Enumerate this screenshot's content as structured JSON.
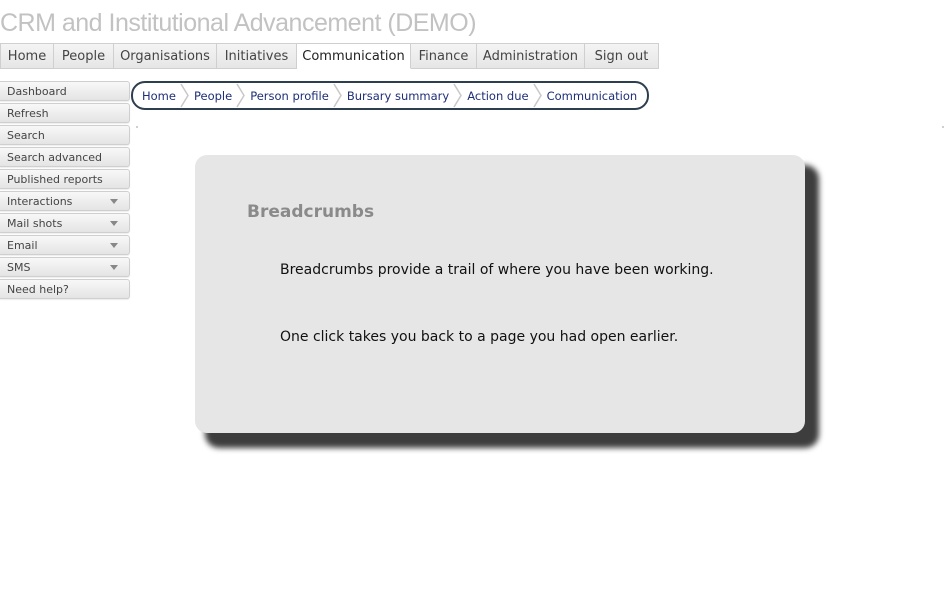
{
  "app": {
    "title": "CRM and Institutional Advancement (DEMO)"
  },
  "main_nav": {
    "tabs": [
      {
        "label": "Home",
        "active": false
      },
      {
        "label": "People",
        "active": false
      },
      {
        "label": "Organisations",
        "active": false
      },
      {
        "label": "Initiatives",
        "active": false
      },
      {
        "label": "Communication",
        "active": true
      },
      {
        "label": "Finance",
        "active": false
      },
      {
        "label": "Administration",
        "active": false
      },
      {
        "label": "Sign out",
        "active": false
      }
    ]
  },
  "side_nav": {
    "items": [
      {
        "label": "Dashboard",
        "has_submenu": false
      },
      {
        "label": "Refresh",
        "has_submenu": false
      },
      {
        "label": "Search",
        "has_submenu": false
      },
      {
        "label": "Search advanced",
        "has_submenu": false
      },
      {
        "label": "Published reports",
        "has_submenu": false
      },
      {
        "label": "Interactions",
        "has_submenu": true
      },
      {
        "label": "Mail shots",
        "has_submenu": true
      },
      {
        "label": "Email",
        "has_submenu": true
      },
      {
        "label": "SMS",
        "has_submenu": true
      },
      {
        "label": "Need help?",
        "has_submenu": false
      }
    ]
  },
  "breadcrumb": {
    "items": [
      "Home",
      "People",
      "Person profile",
      "Bursary summary",
      "Action due",
      "Communication"
    ]
  },
  "info_panel": {
    "heading": "Breadcrumbs",
    "line1": "Breadcrumbs provide a trail of where you have been working.",
    "line2": "One click takes you back to a page you had open earlier."
  },
  "colors": {
    "title": "#c2c2c2",
    "breadcrumb_border": "#2d3e4f",
    "breadcrumb_link": "#1e2f78",
    "panel_bg": "#e6e6e6",
    "panel_heading": "#8a8a8a"
  }
}
